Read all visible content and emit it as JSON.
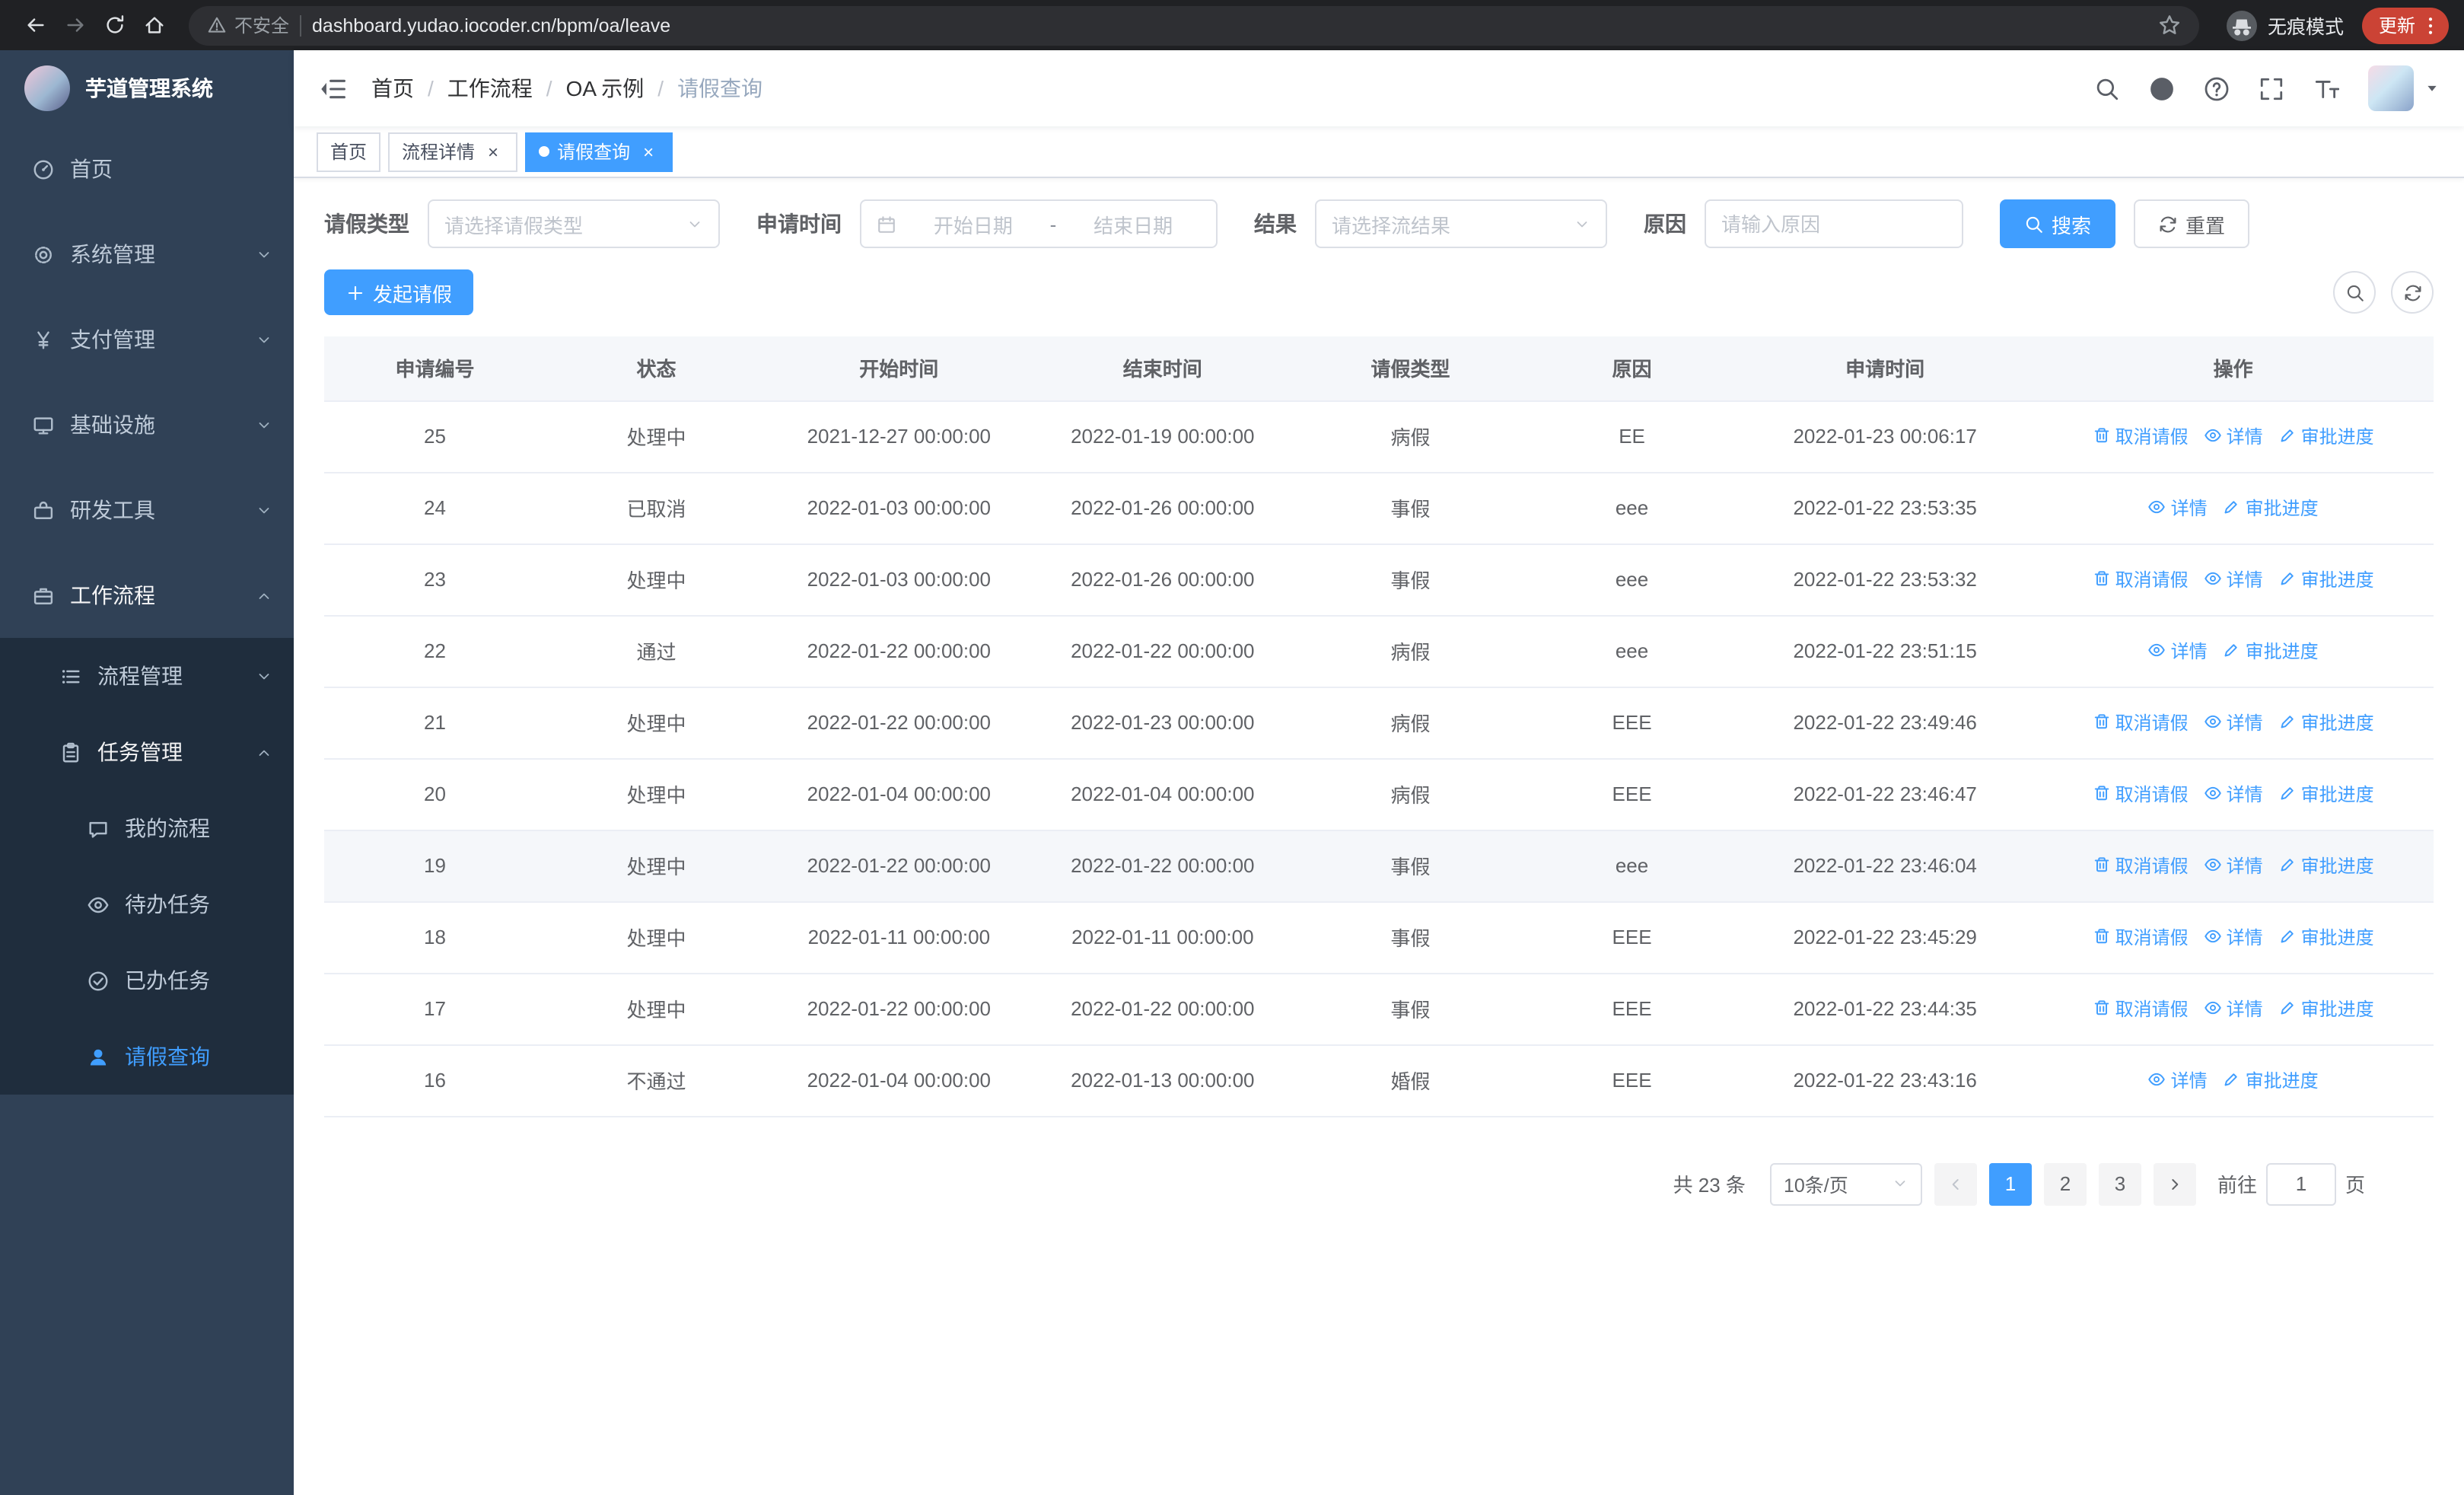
{
  "browser": {
    "security_label": "不安全",
    "url": "dashboard.yudao.iocoder.cn/bpm/oa/leave",
    "incognito_label": "无痕模式",
    "update_label": "更新"
  },
  "sidebar": {
    "app_title": "芋道管理系统",
    "items": [
      {
        "name": "home",
        "label": "首页",
        "icon": "dashboard",
        "level": 1
      },
      {
        "name": "system-management",
        "label": "系统管理",
        "icon": "gear",
        "level": 1,
        "arrow": "down"
      },
      {
        "name": "payment-management",
        "label": "支付管理",
        "icon": "yen",
        "level": 1,
        "arrow": "down"
      },
      {
        "name": "infrastructure",
        "label": "基础设施",
        "icon": "monitor",
        "level": 1,
        "arrow": "down"
      },
      {
        "name": "dev-tools",
        "label": "研发工具",
        "icon": "toolbox",
        "level": 1,
        "arrow": "down"
      },
      {
        "name": "workflow",
        "label": "工作流程",
        "icon": "briefcase",
        "level": 1,
        "arrow": "up",
        "open": true
      },
      {
        "name": "process-management",
        "label": "流程管理",
        "icon": "list",
        "level": 2,
        "arrow": "down"
      },
      {
        "name": "task-management",
        "label": "任务管理",
        "icon": "clipboard",
        "level": 2,
        "arrow": "up",
        "open": true
      },
      {
        "name": "my-process",
        "label": "我的流程",
        "icon": "chat",
        "level": 3
      },
      {
        "name": "todo-task",
        "label": "待办任务",
        "icon": "eye",
        "level": 3
      },
      {
        "name": "done-task",
        "label": "已办任务",
        "icon": "check",
        "level": 3
      },
      {
        "name": "leave-query",
        "label": "请假查询",
        "icon": "user",
        "level": 3,
        "active": true
      }
    ]
  },
  "header": {
    "breadcrumb": [
      "首页",
      "工作流程",
      "OA 示例",
      "请假查询"
    ]
  },
  "tabs": [
    {
      "name": "home",
      "label": "首页",
      "closable": false,
      "active": false
    },
    {
      "name": "process-detail",
      "label": "流程详情",
      "closable": true,
      "active": false
    },
    {
      "name": "leave-query",
      "label": "请假查询",
      "closable": true,
      "active": true
    }
  ],
  "filters": {
    "leave_type": {
      "label": "请假类型",
      "placeholder": "请选择请假类型"
    },
    "apply_time": {
      "label": "申请时间",
      "start_placeholder": "开始日期",
      "separator": "-",
      "end_placeholder": "结束日期"
    },
    "result": {
      "label": "结果",
      "placeholder": "请选择流结果"
    },
    "reason": {
      "label": "原因",
      "placeholder": "请输入原因"
    },
    "search_label": "搜索",
    "reset_label": "重置"
  },
  "toolbar": {
    "create_label": "发起请假"
  },
  "table": {
    "columns": [
      "申请编号",
      "状态",
      "开始时间",
      "结束时间",
      "请假类型",
      "原因",
      "申请时间",
      "操作"
    ],
    "action_labels": {
      "cancel": "取消请假",
      "detail": "详情",
      "progress": "审批进度"
    },
    "rows": [
      {
        "id": "25",
        "status": "处理中",
        "start": "2021-12-27 00:00:00",
        "end": "2022-01-19 00:00:00",
        "type": "病假",
        "reason": "EE",
        "apply": "2022-01-23 00:06:17",
        "cancellable": true
      },
      {
        "id": "24",
        "status": "已取消",
        "start": "2022-01-03 00:00:00",
        "end": "2022-01-26 00:00:00",
        "type": "事假",
        "reason": "eee",
        "apply": "2022-01-22 23:53:35",
        "cancellable": false
      },
      {
        "id": "23",
        "status": "处理中",
        "start": "2022-01-03 00:00:00",
        "end": "2022-01-26 00:00:00",
        "type": "事假",
        "reason": "eee",
        "apply": "2022-01-22 23:53:32",
        "cancellable": true
      },
      {
        "id": "22",
        "status": "通过",
        "start": "2022-01-22 00:00:00",
        "end": "2022-01-22 00:00:00",
        "type": "病假",
        "reason": "eee",
        "apply": "2022-01-22 23:51:15",
        "cancellable": false
      },
      {
        "id": "21",
        "status": "处理中",
        "start": "2022-01-22 00:00:00",
        "end": "2022-01-23 00:00:00",
        "type": "病假",
        "reason": "EEE",
        "apply": "2022-01-22 23:49:46",
        "cancellable": true
      },
      {
        "id": "20",
        "status": "处理中",
        "start": "2022-01-04 00:00:00",
        "end": "2022-01-04 00:00:00",
        "type": "病假",
        "reason": "EEE",
        "apply": "2022-01-22 23:46:47",
        "cancellable": true
      },
      {
        "id": "19",
        "status": "处理中",
        "start": "2022-01-22 00:00:00",
        "end": "2022-01-22 00:00:00",
        "type": "事假",
        "reason": "eee",
        "apply": "2022-01-22 23:46:04",
        "cancellable": true,
        "hovered": true
      },
      {
        "id": "18",
        "status": "处理中",
        "start": "2022-01-11 00:00:00",
        "end": "2022-01-11 00:00:00",
        "type": "事假",
        "reason": "EEE",
        "apply": "2022-01-22 23:45:29",
        "cancellable": true
      },
      {
        "id": "17",
        "status": "处理中",
        "start": "2022-01-22 00:00:00",
        "end": "2022-01-22 00:00:00",
        "type": "事假",
        "reason": "EEE",
        "apply": "2022-01-22 23:44:35",
        "cancellable": true
      },
      {
        "id": "16",
        "status": "不通过",
        "start": "2022-01-04 00:00:00",
        "end": "2022-01-13 00:00:00",
        "type": "婚假",
        "reason": "EEE",
        "apply": "2022-01-22 23:43:16",
        "cancellable": false
      }
    ]
  },
  "pagination": {
    "total_label": "共 23 条",
    "page_size": "10条/页",
    "pages": [
      "1",
      "2",
      "3"
    ],
    "active_page": "1",
    "goto_label": "前往",
    "goto_value": "1",
    "page_suffix": "页"
  },
  "colors": {
    "primary": "#409eff",
    "sidebar_bg": "#304156",
    "submenu_bg": "#1f2d3d"
  }
}
